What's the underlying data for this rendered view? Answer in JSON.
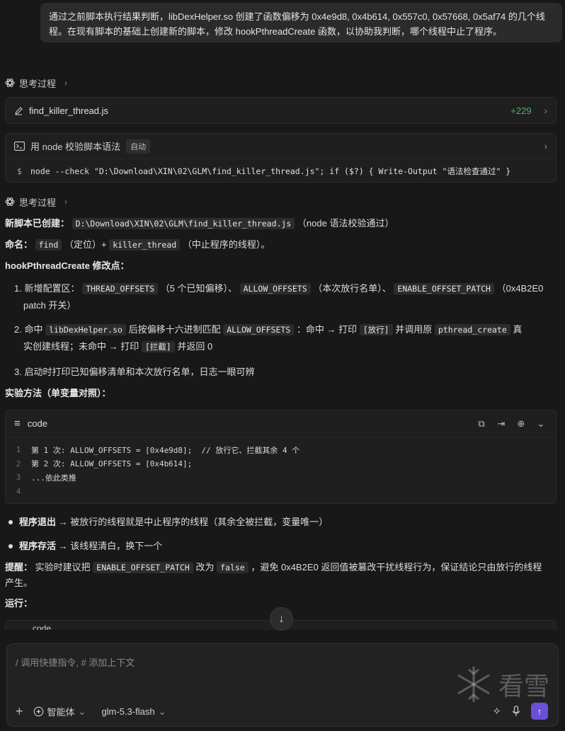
{
  "user_message": "通过之前脚本执行结果判断，libDexHelper.so 创建了函数偏移为 0x4e9d8, 0x4b614, 0x557c0, 0x57668, 0x5af74 的几个线程。在现有脚本的基础上创建新的脚本，修改 hookPthreadCreate 函数，以协助我判断，哪个线程中止了程序。",
  "thinking_label": "思考过程",
  "file_card": {
    "name": "find_killer_thread.js",
    "diff": "+229"
  },
  "cmd_card": {
    "title": "用 node 校验脚本语法",
    "badge": "自动",
    "prompt": "$",
    "command": "node --check \"D:\\Download\\XIN\\02\\GLM\\find_killer_thread.js\"; if ($?) { Write-Output \"语法检查通过\" }"
  },
  "answer": {
    "created_label": "新脚本已创建：",
    "created_path": "D:\\Download\\XIN\\02\\GLM\\find_killer_thread.js",
    "created_note": "（node 语法校验通过）",
    "naming_label": "命名：",
    "naming_find": "find",
    "naming_find_note": "（定位）+",
    "naming_killer": "killer_thread",
    "naming_killer_note": "（中止程序的线程）。",
    "hook_heading": "hookPthreadCreate 修改点：",
    "item1": {
      "prefix": "1. 新增配置区：",
      "c1": "THREAD_OFFSETS",
      "t1": "（5 个已知偏移）、",
      "c2": "ALLOW_OFFSETS",
      "t2": "（本次放行名单）、",
      "c3": "ENABLE_OFFSET_PATCH",
      "t3": "（0x4B2E0",
      "t4": "patch 开关）"
    },
    "item2": {
      "prefix": "2. 命中",
      "c1": "libDexHelper.so",
      "t1": "后按偏移十六进制匹配",
      "c2": "ALLOW_OFFSETS",
      "t2": "：命中 → 打印",
      "c3": "[放行]",
      "t3": "并调用原",
      "c4": "pthread_create",
      "t4": "真",
      "t5": "实创建线程；未命中 → 打印",
      "c5": "[拦截]",
      "t6": "并返回 0"
    },
    "item3": "3. 启动时打印已知偏移清单和本次放行名单，日志一眼可辨",
    "method_heading": "实验方法（单变量对照）：",
    "code_label": "code",
    "code_lines": [
      {
        "n": "1",
        "t": "第 1 次: ALLOW_OFFSETS = [0x4e9d8];  // 放行它、拦截其余 4 个"
      },
      {
        "n": "2",
        "t": "第 2 次: ALLOW_OFFSETS = [0x4b614];"
      },
      {
        "n": "3",
        "t": "...依此类推"
      },
      {
        "n": "4",
        "t": ""
      }
    ],
    "bullet1_bold": "程序退出",
    "bullet1_rest": " → 被放行的线程就是中止程序的线程（其余全被拦截，变量唯一）",
    "bullet2_bold": "程序存活",
    "bullet2_rest": " → 该线程清白，换下一个",
    "tip_label": "提醒：",
    "tip_t1": "实验时建议把",
    "tip_code": "ENABLE_OFFSET_PATCH",
    "tip_t2": "改为",
    "tip_false": "false",
    "tip_t3": "，避免 0x4B2E0 返回值被篡改干扰线程行为，保证结论只由放行的线程",
    "tip_t4": "产生。",
    "run_heading": "运行：",
    "partial_label": "code"
  },
  "composer": {
    "placeholder": "/ 调用快捷指令, # 添加上下文",
    "agent_label": "智能体",
    "model_label": "glm-5.3-flash",
    "watermark_text": "看雪"
  },
  "colors": {
    "accent": "#6b4fd8",
    "diff_green": "#4fae6f",
    "background": "#181818"
  }
}
